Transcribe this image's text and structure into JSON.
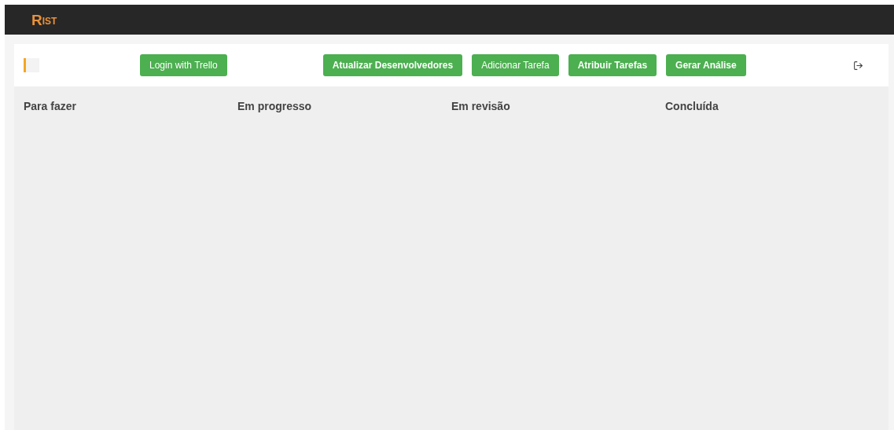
{
  "header": {
    "logo_initial": "R",
    "logo_rest": "IST"
  },
  "toolbar": {
    "login_button": "Login with Trello",
    "buttons": [
      {
        "label": "Atualizar Desenvolvedores",
        "bold": true
      },
      {
        "label": "Adicionar Tarefa",
        "bold": false
      },
      {
        "label": "Atribuir Tarefas",
        "bold": true
      },
      {
        "label": "Gerar Análise",
        "bold": true
      }
    ]
  },
  "columns": [
    "Para fazer",
    "Em progresso",
    "Em revisão",
    "Concluída"
  ]
}
